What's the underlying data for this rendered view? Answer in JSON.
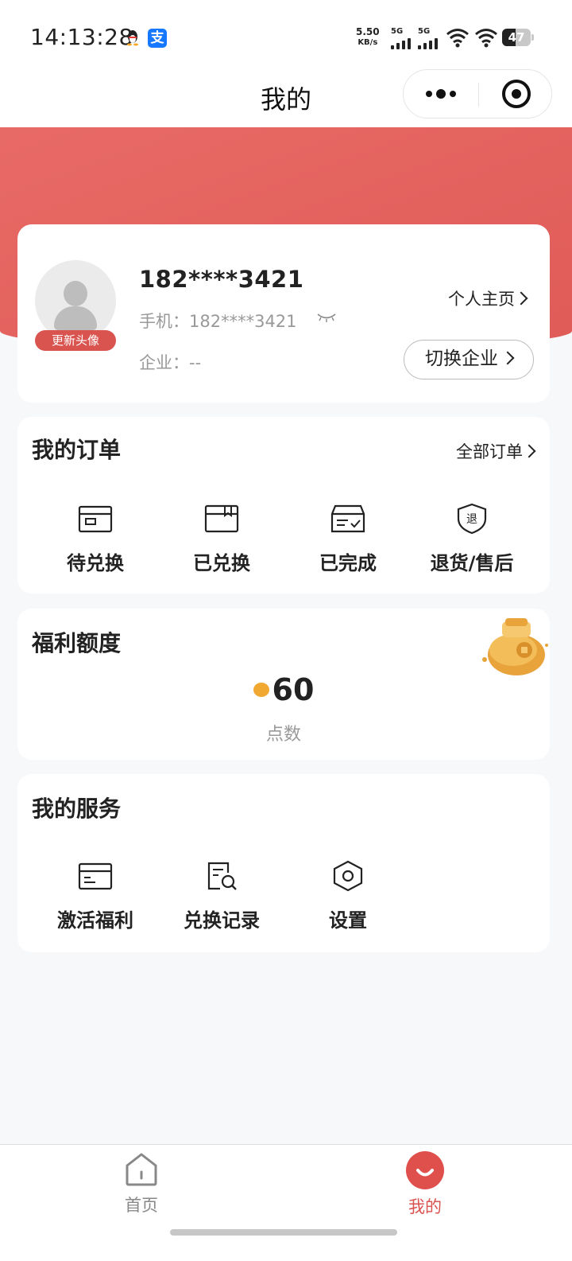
{
  "status_bar": {
    "time": "14:13:28",
    "net_speed_value": "5.50",
    "net_speed_unit": "KB/s",
    "signal1_label": "5G",
    "signal2_label": "5G",
    "battery": "47",
    "battery_level": 0.47
  },
  "nav": {
    "title": "我的"
  },
  "profile": {
    "username": "182****3421",
    "phone_label": "手机：",
    "phone_value": "182****3421",
    "company_label": "企业：",
    "company_value": "--",
    "avatar_badge": "更新头像",
    "homepage_link": "个人主页",
    "switch_company": "切换企业"
  },
  "orders": {
    "title": "我的订单",
    "all_link": "全部订单",
    "items": [
      {
        "label": "待兑换",
        "icon": "card-icon"
      },
      {
        "label": "已兑换",
        "icon": "box-icon"
      },
      {
        "label": "已完成",
        "icon": "box-check-icon"
      },
      {
        "label": "退货/售后",
        "icon": "return-shield-icon",
        "icon_text": "退"
      }
    ]
  },
  "welfare": {
    "title": "福利额度",
    "points": "60",
    "unit": "点数",
    "illustration": "money-bag-icon"
  },
  "services": {
    "title": "我的服务",
    "items": [
      {
        "label": "激活福利",
        "icon": "activate-card-icon"
      },
      {
        "label": "兑换记录",
        "icon": "record-search-icon"
      },
      {
        "label": "设置",
        "icon": "hexagon-settings-icon"
      }
    ]
  },
  "tabbar": {
    "items": [
      {
        "label": "首页",
        "icon": "home-icon",
        "active": false
      },
      {
        "label": "我的",
        "icon": "smile-icon",
        "active": true
      }
    ],
    "active_color": "#d9534f",
    "inactive_color": "#888888"
  },
  "colors": {
    "accent": "#df5b58",
    "background": "#f7f8fa"
  }
}
